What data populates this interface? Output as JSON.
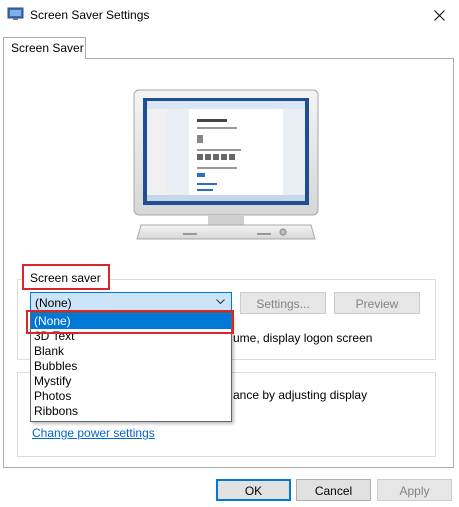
{
  "window": {
    "title": "Screen Saver Settings"
  },
  "tabs": [
    {
      "label": "Screen Saver"
    }
  ],
  "screensaver": {
    "group_label": "Screen saver",
    "selected": "(None)",
    "settings_label": "Settings...",
    "preview_label": "Preview",
    "logon_text_partial": "ume, display logon screen",
    "options": [
      "(None)",
      "3D Text",
      "Blank",
      "Bubbles",
      "Mystify",
      "Photos",
      "Ribbons"
    ]
  },
  "power": {
    "text_partial": "ance by adjusting display",
    "link_label": "Change power settings"
  },
  "footer": {
    "ok_label": "OK",
    "cancel_label": "Cancel",
    "apply_label": "Apply"
  },
  "colors": {
    "accent": "#0078d7",
    "highlight_border": "#d9262d",
    "link": "#0066cc"
  }
}
